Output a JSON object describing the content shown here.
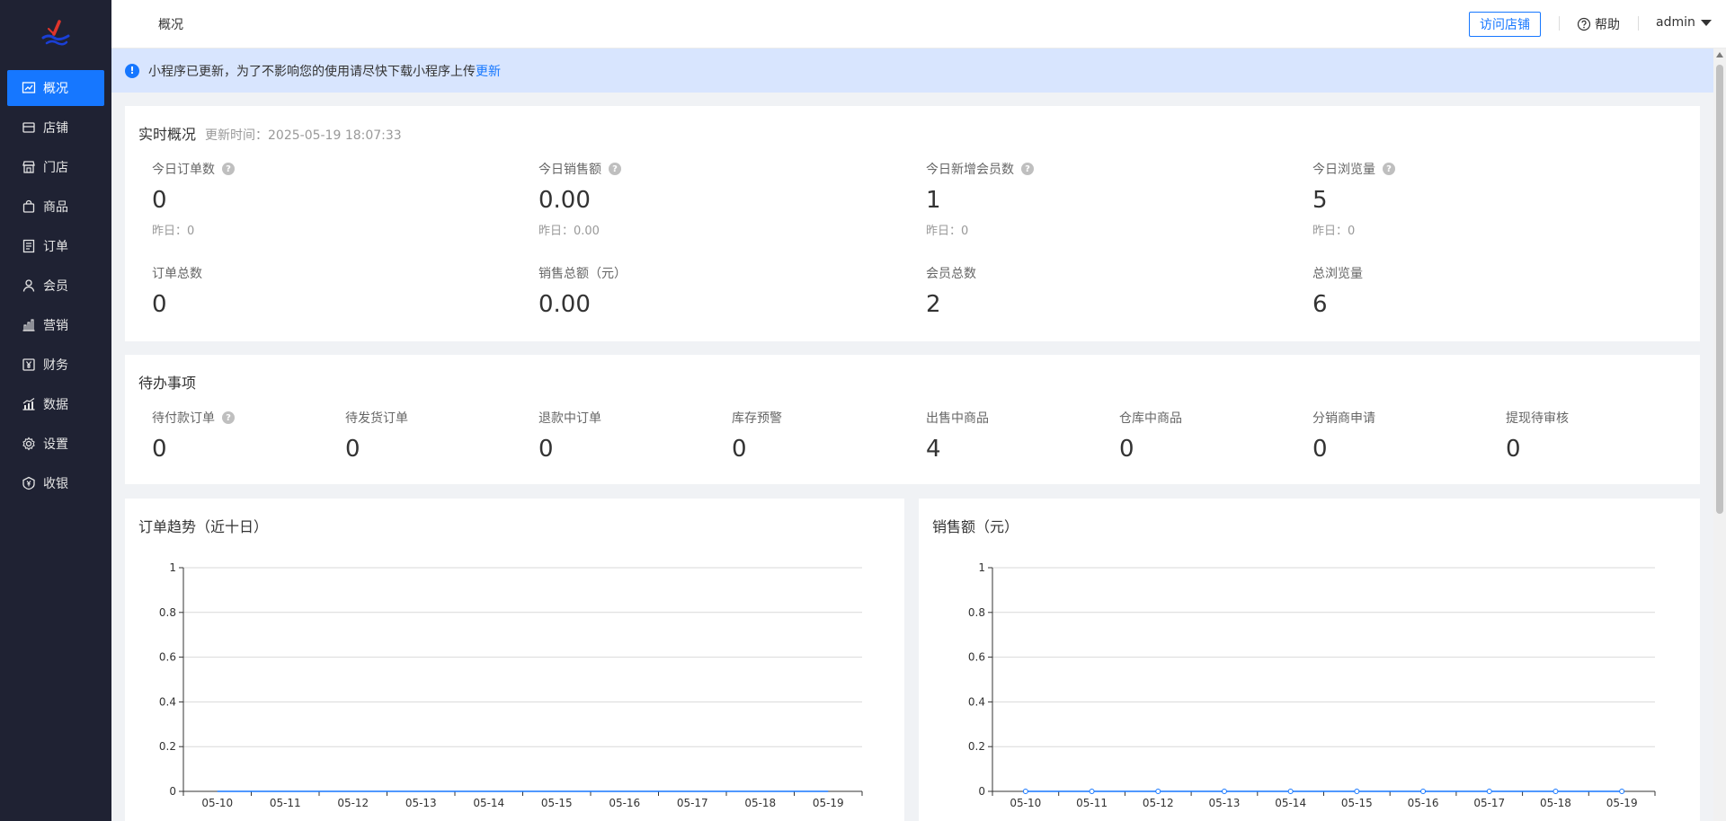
{
  "sidebar": {
    "items": [
      {
        "label": "概况",
        "icon": "chart-line-icon",
        "active": true
      },
      {
        "label": "店铺",
        "icon": "store-icon",
        "active": false
      },
      {
        "label": "门店",
        "icon": "shop-front-icon",
        "active": false
      },
      {
        "label": "商品",
        "icon": "shopping-bag-icon",
        "active": false
      },
      {
        "label": "订单",
        "icon": "order-list-icon",
        "active": false
      },
      {
        "label": "会员",
        "icon": "user-icon",
        "active": false
      },
      {
        "label": "营销",
        "icon": "bar-chart-icon",
        "active": false
      },
      {
        "label": "财务",
        "icon": "yuan-icon",
        "active": false
      },
      {
        "label": "数据",
        "icon": "data-chart-icon",
        "active": false
      },
      {
        "label": "设置",
        "icon": "gear-icon",
        "active": false
      },
      {
        "label": "收银",
        "icon": "cashier-icon",
        "active": false
      }
    ]
  },
  "header": {
    "title": "概况",
    "visit_store": "访问店铺",
    "help": "帮助",
    "user": "admin"
  },
  "notice": {
    "text": "小程序已更新，为了不影响您的使用请尽快下载小程序上传",
    "link": "更新"
  },
  "realtime": {
    "title": "实时概况",
    "updated": "更新时间：2025-05-19 18:07:33",
    "today": [
      {
        "label": "今日订单数",
        "value": "0",
        "yesterday": "昨日：0"
      },
      {
        "label": "今日销售额",
        "value": "0.00",
        "yesterday": "昨日：0.00"
      },
      {
        "label": "今日新增会员数",
        "value": "1",
        "yesterday": "昨日：0"
      },
      {
        "label": "今日浏览量",
        "value": "5",
        "yesterday": "昨日：0"
      }
    ],
    "totals": [
      {
        "label": "订单总数",
        "value": "0"
      },
      {
        "label": "销售总额（元）",
        "value": "0.00"
      },
      {
        "label": "会员总数",
        "value": "2"
      },
      {
        "label": "总浏览量",
        "value": "6"
      }
    ]
  },
  "todo": {
    "title": "待办事项",
    "items": [
      {
        "label": "待付款订单",
        "value": "0"
      },
      {
        "label": "待发货订单",
        "value": "0"
      },
      {
        "label": "退款中订单",
        "value": "0"
      },
      {
        "label": "库存预警",
        "value": "0"
      },
      {
        "label": "出售中商品",
        "value": "4"
      },
      {
        "label": "仓库中商品",
        "value": "0"
      },
      {
        "label": "分销商申请",
        "value": "0"
      },
      {
        "label": "提现待审核",
        "value": "0"
      }
    ]
  },
  "colors": {
    "accent": "#1677ff",
    "sidebar": "#1f2233",
    "notice_bg": "#d8e5fe",
    "series_line": "#1677ff"
  },
  "chart_data": [
    {
      "type": "line",
      "title": "订单趋势（近十日）",
      "categories": [
        "05-10",
        "05-11",
        "05-12",
        "05-13",
        "05-14",
        "05-15",
        "05-16",
        "05-17",
        "05-18",
        "05-19"
      ],
      "series": [
        {
          "values": [
            0,
            0,
            0,
            0,
            0,
            0,
            0,
            0,
            0,
            0
          ]
        }
      ],
      "ylim": [
        0,
        1
      ],
      "yticks": [
        "0",
        "0.2",
        "0.4",
        "0.6",
        "0.8",
        "1"
      ],
      "grid": true,
      "show_points": false
    },
    {
      "type": "line",
      "title": "销售额（元）",
      "categories": [
        "05-10",
        "05-11",
        "05-12",
        "05-13",
        "05-14",
        "05-15",
        "05-16",
        "05-17",
        "05-18",
        "05-19"
      ],
      "series": [
        {
          "values": [
            0,
            0,
            0,
            0,
            0,
            0,
            0,
            0,
            0,
            0
          ]
        }
      ],
      "ylim": [
        0,
        1
      ],
      "yticks": [
        "0",
        "0.2",
        "0.4",
        "0.6",
        "0.8",
        "1"
      ],
      "grid": true,
      "show_points": true
    }
  ]
}
